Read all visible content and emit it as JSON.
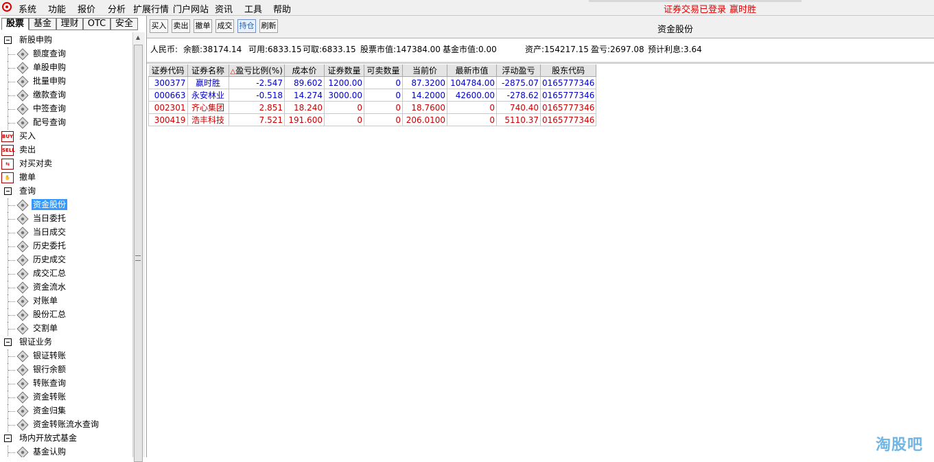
{
  "menu": {
    "items": [
      "系统",
      "功能",
      "报价",
      "分析",
      "扩展行情",
      "门户网站",
      "资讯",
      "工具",
      "帮助"
    ],
    "status": "证券交易已登录",
    "user": "赢时胜"
  },
  "left_tabs": [
    "股票",
    "基金",
    "理财",
    "OTC",
    "安全"
  ],
  "tree": [
    {
      "label": "新股申购",
      "kind": "group"
    },
    {
      "label": "额度查询",
      "kind": "leaf"
    },
    {
      "label": "单股申购",
      "kind": "leaf"
    },
    {
      "label": "批量申购",
      "kind": "leaf"
    },
    {
      "label": "缴款查询",
      "kind": "leaf"
    },
    {
      "label": "中签查询",
      "kind": "leaf"
    },
    {
      "label": "配号查询",
      "kind": "leaf"
    },
    {
      "label": "买入",
      "kind": "action",
      "icon": "BUY"
    },
    {
      "label": "卖出",
      "kind": "action",
      "icon": "SELL"
    },
    {
      "label": "对买对卖",
      "kind": "action",
      "icon": "⇆"
    },
    {
      "label": "撤单",
      "kind": "action",
      "icon": "✋"
    },
    {
      "label": "查询",
      "kind": "group"
    },
    {
      "label": "资金股份",
      "kind": "leaf",
      "selected": true
    },
    {
      "label": "当日委托",
      "kind": "leaf"
    },
    {
      "label": "当日成交",
      "kind": "leaf"
    },
    {
      "label": "历史委托",
      "kind": "leaf"
    },
    {
      "label": "历史成交",
      "kind": "leaf"
    },
    {
      "label": "成交汇总",
      "kind": "leaf"
    },
    {
      "label": "资金流水",
      "kind": "leaf"
    },
    {
      "label": "对账单",
      "kind": "leaf"
    },
    {
      "label": "股份汇总",
      "kind": "leaf"
    },
    {
      "label": "交割单",
      "kind": "leaf"
    },
    {
      "label": "银证业务",
      "kind": "group"
    },
    {
      "label": "银证转账",
      "kind": "leaf"
    },
    {
      "label": "银行余额",
      "kind": "leaf"
    },
    {
      "label": "转账查询",
      "kind": "leaf"
    },
    {
      "label": "资金转账",
      "kind": "leaf"
    },
    {
      "label": "资金归集",
      "kind": "leaf"
    },
    {
      "label": "资金转账流水查询",
      "kind": "leaf"
    },
    {
      "label": "场内开放式基金",
      "kind": "group"
    },
    {
      "label": "基金认购",
      "kind": "leaf"
    }
  ],
  "toolbar": {
    "buttons": [
      "买入",
      "卖出",
      "撤单",
      "成交",
      "持仓",
      "刷新"
    ],
    "active": "持仓",
    "title": "资金股份"
  },
  "summary": {
    "currency": "人民币:",
    "balance": "余额:38174.14",
    "available": "可用:6833.15",
    "withdrawable": "可取:6833.15",
    "stock_value": "股票市值:147384.00",
    "fund_value": "基金市值:0.00",
    "assets": "资产:154217.15",
    "profit": "盈亏:2697.08",
    "interest": "预计利息:3.64"
  },
  "table": {
    "sort_marker": "△",
    "columns": [
      "证券代码",
      "证券名称",
      "盈亏比例(%)",
      "成本价",
      "证券数量",
      "可卖数量",
      "当前价",
      "最新市值",
      "浮动盈亏",
      "股东代码"
    ],
    "rows": [
      {
        "color": "blue",
        "cells": [
          "300377",
          "赢时胜",
          "-2.547",
          "89.602",
          "1200.00",
          "0",
          "87.3200",
          "104784.00",
          "-2875.07",
          "0165777346"
        ]
      },
      {
        "color": "blue",
        "cells": [
          "000663",
          "永安林业",
          "-0.518",
          "14.274",
          "3000.00",
          "0",
          "14.2000",
          "42600.00",
          "-278.62",
          "0165777346"
        ]
      },
      {
        "color": "red",
        "cells": [
          "002301",
          "齐心集团",
          "2.851",
          "18.240",
          "0",
          "0",
          "18.7600",
          "0",
          "740.40",
          "0165777346"
        ]
      },
      {
        "color": "red",
        "cells": [
          "300419",
          "浩丰科技",
          "7.521",
          "191.600",
          "0",
          "0",
          "206.0100",
          "0",
          "5110.37",
          "0165777346"
        ]
      }
    ]
  },
  "watermark": "淘股吧"
}
